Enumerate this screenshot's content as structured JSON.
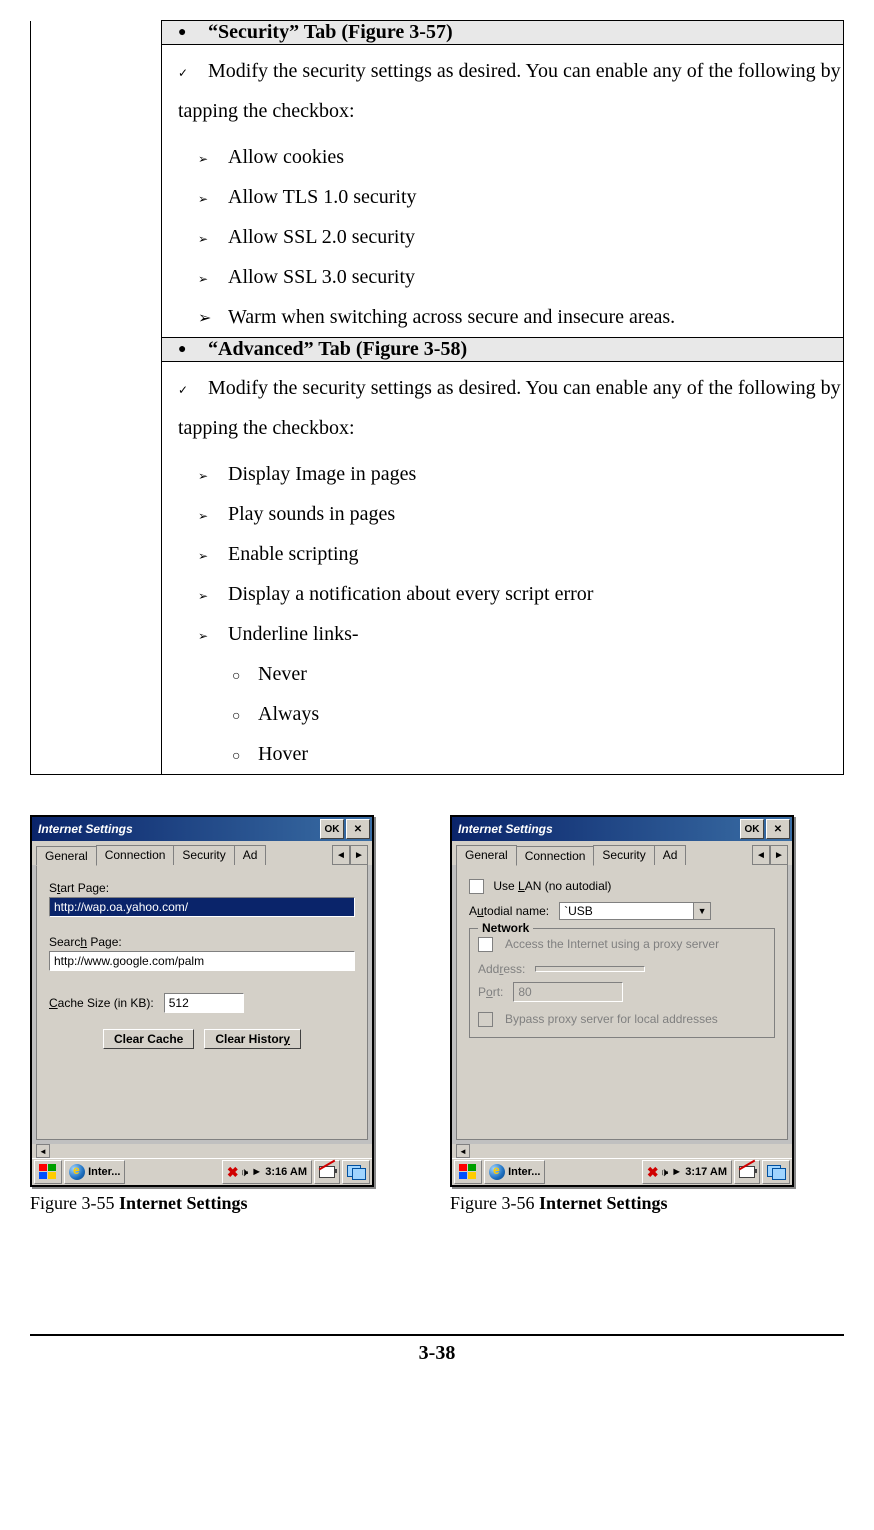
{
  "table": {
    "security_header": "“Security” Tab (Figure 3-57)",
    "security_intro": "Modify the security settings as desired. You can enable any of the following by tapping the checkbox:",
    "security_items": {
      "i0": "Allow cookies",
      "i1": "Allow TLS 1.0 security",
      "i2": "Allow SSL 2.0 security",
      "i3": "Allow SSL 3.0 security",
      "i4": "Warm when switching across secure and insecure areas."
    },
    "advanced_header": "“Advanced” Tab (Figure 3-58)",
    "advanced_intro": "Modify the security settings as desired. You can enable any of the following by tapping the checkbox:",
    "advanced_items": {
      "i0": "Display Image in pages",
      "i1": "Play sounds in pages",
      "i2": "Enable scripting",
      "i3": "Display a notification about every script error",
      "i4": "Underline links-"
    },
    "underline_opts": {
      "o0": "Never",
      "o1": "Always",
      "o2": "Hover"
    }
  },
  "shot_left": {
    "title": "Internet Settings",
    "ok": "OK",
    "close": "✕",
    "tabs": {
      "t0": "General",
      "t1": "Connection",
      "t2": "Security",
      "t3": "Ad"
    },
    "start_label_pre": "S",
    "start_label_und": "t",
    "start_label_post": "art Page:",
    "start_value": "http://wap.oa.yahoo.com/",
    "search_label_pre": "Searc",
    "search_label_und": "h",
    "search_label_post": " Page:",
    "search_value": "http://www.google.com/palm",
    "cache_label_pre": "",
    "cache_label_und": "C",
    "cache_label_post": "ache Size (in KB):",
    "cache_value": "512",
    "clear_cache": "Clear Cache",
    "clear_history_pre": "Clear Histor",
    "clear_history_und": "y",
    "task_app": "Inter...",
    "time": "3:16 AM",
    "caption_fig": "Figure 3-55 ",
    "caption_title": "Internet Settings"
  },
  "shot_right": {
    "title": "Internet Settings",
    "ok": "OK",
    "close": "✕",
    "tabs": {
      "t0": "General",
      "t1": "Connection",
      "t2": "Security",
      "t3": "Ad"
    },
    "uselan_pre": "Use ",
    "uselan_und": "L",
    "uselan_post": "AN (no autodial)",
    "autodial_pre": "A",
    "autodial_und": "u",
    "autodial_post": "todial name:",
    "autodial_value": "`USB",
    "network_legend": "Network",
    "proxy_text": "Access the Internet using a proxy server",
    "address_pre": "Add",
    "address_und": "r",
    "address_post": "ess:",
    "port_pre": "P",
    "port_und": "o",
    "port_post": "rt:",
    "port_value": "80",
    "bypass_text": "Bypass proxy server for local addresses",
    "task_app": "Inter...",
    "time": "3:17 AM",
    "caption_fig": "Figure 3-56 ",
    "caption_title": "Internet Settings"
  },
  "page_number": "3-38"
}
